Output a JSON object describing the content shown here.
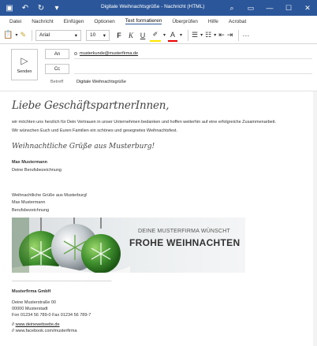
{
  "titlebar": {
    "title": "Digitale Weihnachtsgrüße  -  Nachricht (HTML)",
    "save_icon": "save-icon",
    "undo_icon": "undo-icon",
    "redo_icon": "redo-icon",
    "qa_more": "customize-quick-access-icon",
    "search_glyph": "⌕",
    "layout_glyph": "▭",
    "min_glyph": "—",
    "max_glyph": "☐",
    "close_glyph": "✕"
  },
  "menu": {
    "tabs": [
      "Datei",
      "Nachricht",
      "Einfügen",
      "Optionen",
      "Text formatieren",
      "Überprüfen",
      "Hilfe",
      "Acrobat"
    ],
    "active_tab": "Text formatieren"
  },
  "ribbon": {
    "font": "Arial",
    "size": "10",
    "bold": "F",
    "italic": "K",
    "underline": "U",
    "text_color": "A",
    "more": "···"
  },
  "compose": {
    "send_label": "Senden",
    "to_label": "An",
    "cc_label": "Cc",
    "to_value": "musterkunde@musterfirma.de",
    "cc_value": "",
    "subject_label": "Betreff",
    "subject_value": "Digitale Weihnachtsgrüße"
  },
  "body": {
    "greeting": "Liebe GeschäftspartnerInnen,",
    "para1": "wir möchten uns herzlich für Dein Vertrauen in unser Unternehmen bedanken und hoffen weiterhin auf eine erfolgreiche Zusammenarbeit.",
    "para2": "Wir wünschen Euch und Euren Familien ein schönes und gesegnetes Weihnachtsfest.",
    "regards_script": "Weihnachtliche Grüße aus Musterburg!",
    "name1": "Max Mustermann",
    "title1": "Deine Berufsbezeichnung",
    "regards_plain": "Weihnachtliche Grüße aus Musterburg!",
    "name2": "Max Mustermann",
    "title2": "Berufsbezeichnung",
    "banner_line1": "DEINE MUSTERFIRMA WÜNSCHT",
    "banner_line2": "FROHE WEIHNACHTEN",
    "divider": "————————————————————————————",
    "company": "Musterfirma GmbH",
    "street": "Deine Musterstraße 00",
    "city": "00000 Musterstadt",
    "phone": "Fon 01234 56 789-0 Fax 01234 56 789-7",
    "web_prefix": "// ",
    "web": "www.deinewebseite.de",
    "facebook": "// www.facebook.com/musterfirma"
  },
  "colors": {
    "accent": "#2b579a",
    "ornament_green": "#3f8f2e",
    "ornament_grey": "#9aa3a8"
  }
}
